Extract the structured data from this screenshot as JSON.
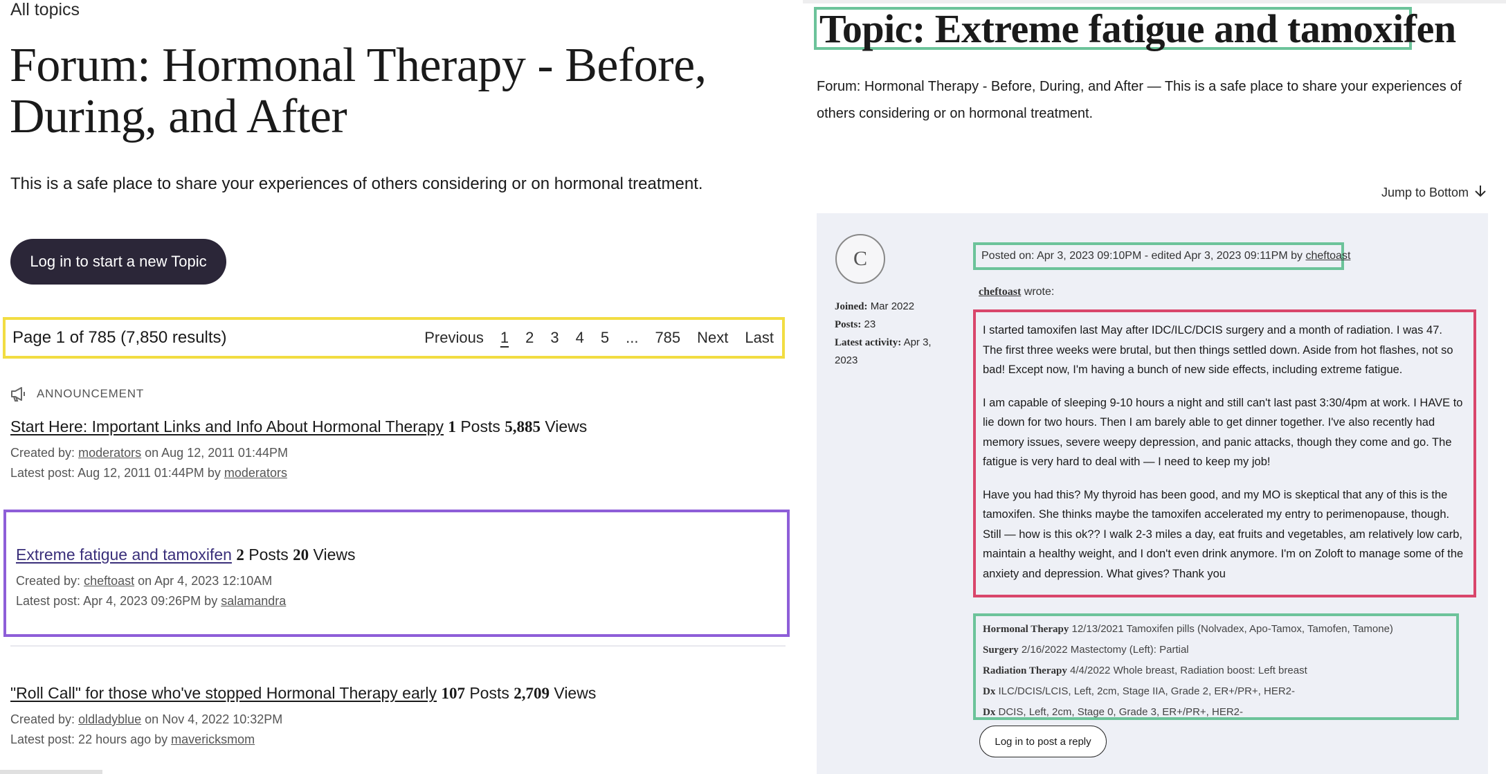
{
  "left": {
    "breadcrumb": "All topics",
    "forum_title": "Forum: Hormonal Therapy - Before, During, and After",
    "forum_description": "This is a safe place to share your experiences of others considering or on hormonal treatment.",
    "new_topic_button": "Log in to start a new Topic",
    "pagination": {
      "summary": "Page 1 of 785 (7,850 results)",
      "previous": "Previous",
      "pages": [
        "1",
        "2",
        "3",
        "4",
        "5",
        "...",
        "785"
      ],
      "current_page": "1",
      "next": "Next",
      "last": "Last"
    },
    "announcement_label": "ANNOUNCEMENT",
    "topics": [
      {
        "title": "Start Here: Important Links and Info About Hormonal Therapy",
        "posts_count": "1",
        "posts_label": "Posts",
        "views_count": "5,885",
        "views_label": "Views",
        "created_prefix": "Created by:",
        "created_by": "moderators",
        "created_on": "on Aug 12, 2011 01:44PM",
        "latest_prefix": "Latest post: Aug 12, 2011 01:44PM by",
        "latest_by": "moderators"
      },
      {
        "title": "Extreme fatigue and tamoxifen",
        "posts_count": "2",
        "posts_label": "Posts",
        "views_count": "20",
        "views_label": "Views",
        "created_prefix": "Created by:",
        "created_by": "cheftoast",
        "created_on": "on Apr 4, 2023 12:10AM",
        "latest_prefix": "Latest post: Apr 4, 2023 09:26PM by",
        "latest_by": "salamandra"
      },
      {
        "title": "\"Roll Call\" for those who've stopped Hormonal Therapy early",
        "posts_count": "107",
        "posts_label": "Posts",
        "views_count": "2,709",
        "views_label": "Views",
        "created_prefix": "Created by:",
        "created_by": "oldladyblue",
        "created_on": "on Nov 4, 2022 10:32PM",
        "latest_prefix": "Latest post: 22 hours ago by",
        "latest_by": "mavericksmom"
      }
    ]
  },
  "right": {
    "topic_title": "Topic: Extreme fatigue and tamoxifen",
    "forum_description": "Forum: Hormonal Therapy - Before, During, and After — This is a safe place to share your experiences of others considering or on hormonal treatment.",
    "jump_bottom": "Jump to Bottom",
    "post": {
      "avatar_letter": "C",
      "joined_label": "Joined:",
      "joined_value": "Mar 2022",
      "posts_label": "Posts:",
      "posts_value": "23",
      "activity_label": "Latest activity:",
      "activity_value": "Apr 3, 2023",
      "posted_text": "Posted on: Apr 3, 2023 09:10PM - edited Apr 3, 2023 09:11PM by",
      "posted_by": "cheftoast",
      "wrote_user": "cheftoast",
      "wrote_suffix": "wrote:",
      "paragraphs": [
        "I started tamoxifen last May after IDC/ILC/DCIS surgery and a month of radiation. I was 47. The first three weeks were brutal, but then things settled down. Aside from hot flashes, not so bad! Except now, I'm having a bunch of new side effects, including extreme fatigue.",
        "I am capable of sleeping 9-10 hours a night and still can't last past 3:30/4pm at work. I HAVE to lie down for two hours. Then I am barely able to get dinner together. I've also recently had memory issues, severe weepy depression, and panic attacks, though they come and go. The fatigue is very hard to deal with — I need to keep my job!",
        "Have you had this? My thyroid has been good, and my MO is skeptical that any of this is the tamoxifen. She thinks maybe the tamoxifen accelerated my entry to perimenopause, though. Still — how is this ok?? I walk 2-3 miles a day, eat fruits and vegetables, am relatively low carb, maintain a healthy weight, and I don't even drink anymore. I'm on Zoloft to manage some of the anxiety and depression. What gives? Thank you"
      ],
      "signature": [
        {
          "label": "Hormonal Therapy",
          "value": "12/13/2021 Tamoxifen pills (Nolvadex, Apo-Tamox, Tamofen, Tamone)"
        },
        {
          "label": "Surgery",
          "value": "2/16/2022 Mastectomy (Left): Partial"
        },
        {
          "label": "Radiation Therapy",
          "value": "4/4/2022 Whole breast, Radiation boost: Left breast"
        },
        {
          "label": "Dx",
          "value": "ILC/DCIS/LCIS, Left, 2cm, Stage IIA, Grade 2, ER+/PR+, HER2-"
        },
        {
          "label": "Dx",
          "value": "DCIS, Left, 2cm, Stage 0, Grade 3, ER+/PR+, HER2-"
        }
      ],
      "reply_button": "Log in to post a reply"
    }
  },
  "colors": {
    "primary_button": "#2b2638",
    "highlight_yellow": "#f2dd42",
    "highlight_purple": "#8e5ed8",
    "highlight_green": "#6cc39a",
    "highlight_red": "#d9466b",
    "post_background": "#eef0f6"
  },
  "icons": [
    "megaphone-icon",
    "arrow-down-icon"
  ]
}
